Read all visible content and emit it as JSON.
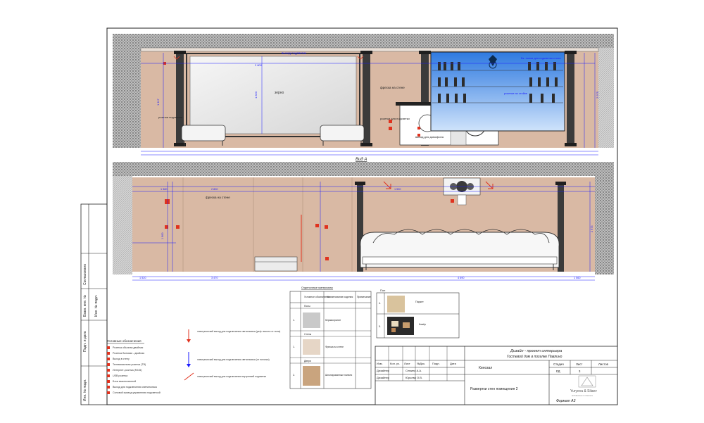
{
  "drawing": {
    "view_a_label": "Вид А",
    "wall_finish": "фреска на стене",
    "mirror_label": "зерно",
    "mirror_height": "1 820",
    "led_strip": "выход подсветки",
    "bottle_caption": "Бк. полки для подсветки стола",
    "shelves_label": "розетки на стойке",
    "sconce_label": "розетки подсветки",
    "sconce_label_2": "выход для домофона",
    "niche_label": "розетки для подсветки",
    "niche_label_2": "выход для домофона",
    "dims_top": [
      "1 380",
      "2 800",
      "1 590"
    ],
    "dims_bottom": [
      "1 520",
      "3 470",
      "4 690",
      "1 560"
    ],
    "vertical_dims": [
      "1 117",
      "1 900",
      "2 975"
    ]
  },
  "side_stamp": {
    "cells": [
      "Согласовано",
      "Взам. инв. №",
      "Инв. № подл.",
      "Подп. и дата",
      "Инв. № подл."
    ]
  },
  "legend": {
    "title": "Условные обозначения",
    "items": [
      "Розетка обычная двойная",
      "Розетка бытовая - двойная",
      "Выход в стену",
      "Телевизионная розетка (ТВ)",
      "Интернет-розетка (RJ45)",
      "USB розетка",
      "Блок выключателей",
      "Выход для подключения светильника",
      "Силовой провод управления подсветкой"
    ],
    "notes": [
      "электрический выход для подключения светильника (реф. высота от пола)",
      "электрический выход для подключения светильника (от потолка)",
      "электрический выход для подключения внутренней подсветки"
    ]
  },
  "finish_table": {
    "title": "Отделочные материалы",
    "headers": [
      "Условное обозначение",
      "Наименование изделия",
      "Примечание"
    ],
    "sections": [
      "Полы",
      "Стены",
      "Двери"
    ],
    "rows": [
      {
        "num": "1.",
        "name": "Керамогранит"
      },
      {
        "num": "1.",
        "name": "Фреска на стене"
      },
      {
        "num": "2.",
        "name": "Шпонированные панели"
      }
    ]
  },
  "samples": {
    "title": "Пол",
    "rows": [
      {
        "num": "4.",
        "text": "Паркет"
      },
      {
        "num": "5.",
        "text": "Ковёр"
      }
    ]
  },
  "title_block": {
    "headers": [
      "Изм.",
      "Кол. уч.",
      "Лист",
      "№Док.",
      "Подп.",
      "Дата"
    ],
    "row1": [
      "Дизайнер",
      "Семина А.А."
    ],
    "row2": [
      "Дизайнер",
      "Юрьева О.В."
    ],
    "project": "Дизайн - проект интерьера",
    "project_sub": "Гостевой дом в поселке Павлино",
    "room": "Кинозал",
    "sheet_title": "Развертки стен помещения 2",
    "stage_header": "Стадия",
    "sheet_header": "Лист",
    "sheets_header": "Листов",
    "stage": "РД",
    "sheet": "3",
    "company": "Yuryeva & Silaev",
    "company_sub": "architecture & interiors",
    "format": "Формат А3"
  },
  "colors": {
    "wall": "#d9b9a4",
    "dim": "#1a1aff",
    "red": "#e0321e",
    "hatch": "#444444",
    "sky": "#5d9ee6"
  }
}
